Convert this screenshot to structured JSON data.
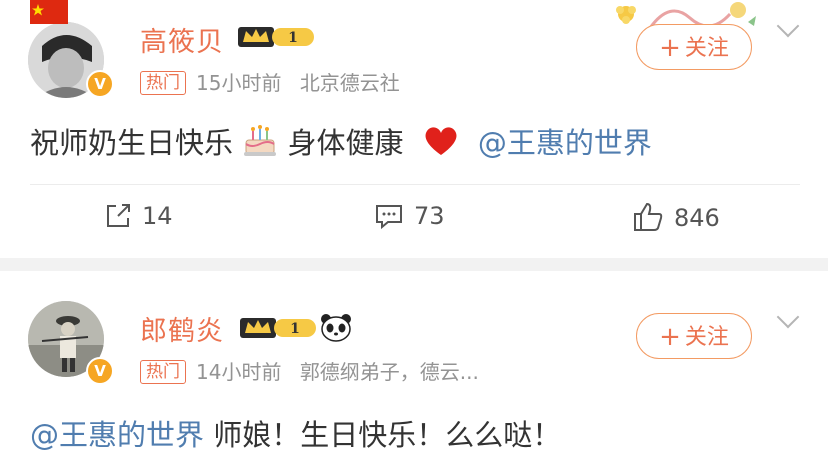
{
  "posts": [
    {
      "author": "高筱贝",
      "vip_level": "1",
      "hot_label": "热门",
      "time": "15小时前",
      "source": "北京德云社",
      "follow_label": "关注",
      "text_before": "祝师奶生日快乐",
      "text_middle": "身体健康",
      "mention": "@王惠的世界",
      "text_after": "",
      "repost_count": "14",
      "comment_count": "73",
      "like_count": "846"
    },
    {
      "author": "郎鹤炎",
      "vip_level": "1",
      "hot_label": "热门",
      "time": "14小时前",
      "source": "郭德纲弟子，德云...",
      "follow_label": "关注",
      "mention": "@王惠的世界",
      "text_after": "师娘！生日快乐！么么哒！"
    }
  ],
  "colors": {
    "name": "#eb7350",
    "mention": "#507daf",
    "meta": "#939393",
    "separator": "#f2f2f2"
  },
  "icons": [
    "verified-v-icon",
    "vip-crown-icon",
    "repost-icon",
    "comment-icon",
    "like-icon",
    "cake-emoji",
    "heart-emoji",
    "panda-emoji",
    "flag-icon"
  ]
}
